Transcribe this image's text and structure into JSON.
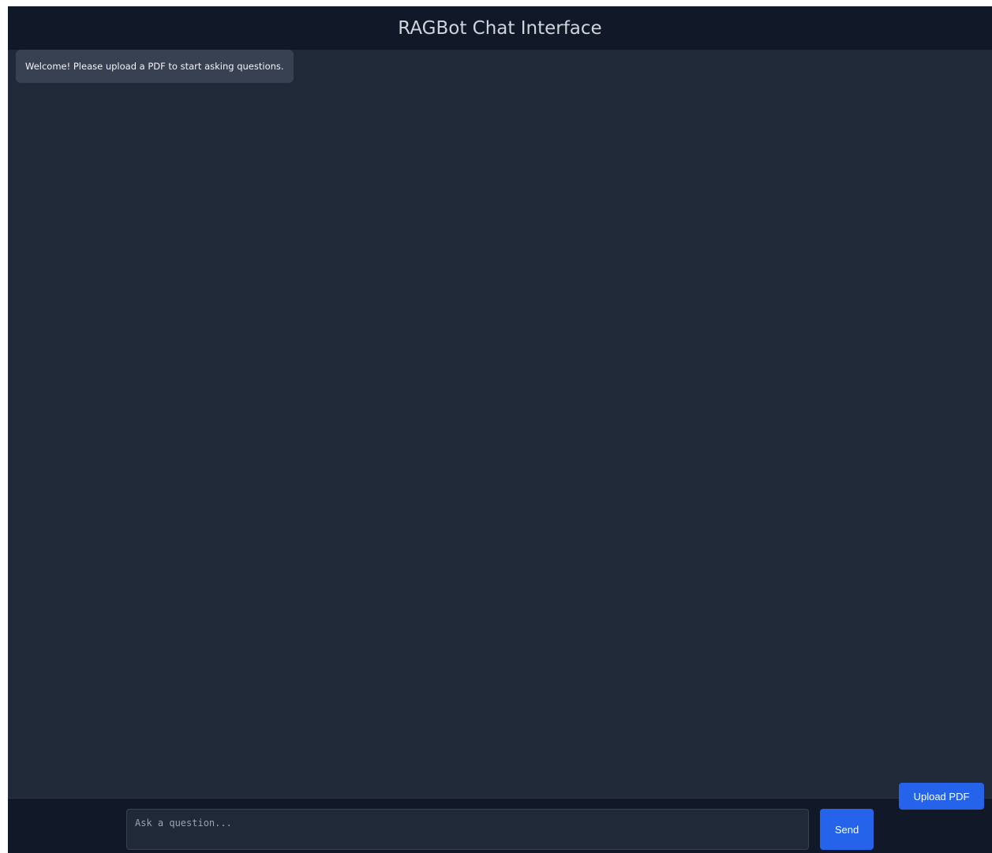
{
  "header": {
    "title": "RAGBot Chat Interface"
  },
  "chat": {
    "messages": [
      {
        "role": "bot",
        "text": "Welcome! Please upload a PDF to start asking questions."
      }
    ]
  },
  "composer": {
    "placeholder": "Ask a question...",
    "value": "",
    "send_label": "Send"
  },
  "upload": {
    "label": "Upload PDF"
  },
  "colors": {
    "page_background": "#1f2937",
    "header_background": "#111827",
    "bot_bubble": "#374151",
    "accent": "#2563eb"
  }
}
